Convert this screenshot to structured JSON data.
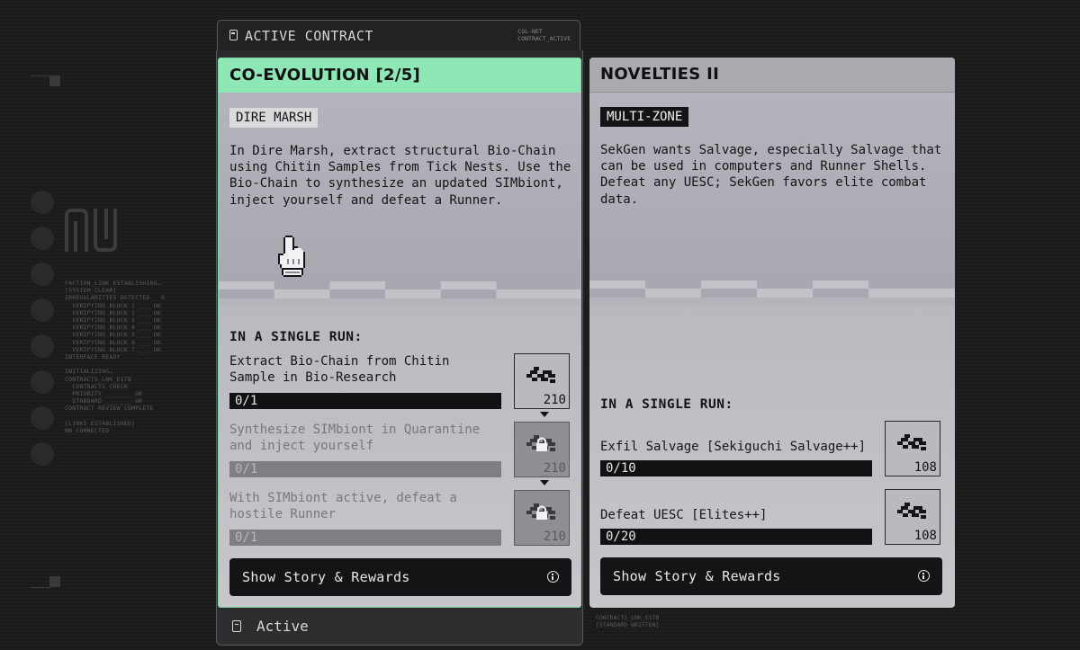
{
  "header": {
    "title": "ACTIVE CONTRACT",
    "meta_line1": "COL-NET",
    "meta_line2": "CONTRACT_ACTIVE"
  },
  "side_log": {
    "lines": [
      "FACTION_LINK ESTABLISHING…",
      "[SYSTEM CLEAR]",
      "IRREGULARITIES DETECTED _ 0",
      "  VERIFYING BLOCK 1 ___ OK",
      "  VERIFYING BLOCK 2 ___ OK",
      "  VERIFYING BLOCK 3 ___ OK",
      "  VERIFYING BLOCK 4 ___ OK",
      "  VERIFYING BLOCK 5 ___ OK",
      "  VERIFYING BLOCK 6 ___ OK",
      "  VERIFYING BLOCK 7 ___ OK",
      "INTERFACE READY",
      "",
      "INITIALIZING…",
      "CONTRACTS_LNK_ESTB",
      "  CONTRACTS CHECK",
      "  PRIORITY _______ OK",
      "  STANDARD _______ OK",
      "CONTRACT REVIEW COMPLETE",
      "",
      "[LINKS ESTABLISHED]",
      "NN CONNECTED"
    ]
  },
  "footer_tiny": {
    "line1": "CONTRACTS_LNK_ESTB",
    "line2": "[STANDARD WRITTEN]"
  },
  "contracts": [
    {
      "title": "CO-EVOLUTION [2/5]",
      "zone": "DIRE MARSH",
      "description": "In Dire Marsh, extract structural Bio-Chain using Chitin Samples from Tick Nests. Use the Bio-Chain to synthesize an updated SIMbiont, inject yourself and defeat a Runner.",
      "section_label": "IN A SINGLE RUN:",
      "tasks": [
        {
          "label": "Extract Bio-Chain from Chitin Sample in Bio-Research",
          "progress": "0/1",
          "reward": "210",
          "locked": false
        },
        {
          "label": "Synthesize SIMbiont in Quarantine and inject yourself",
          "progress": "0/1",
          "reward": "210",
          "locked": true
        },
        {
          "label": "With SIMbiont active, defeat a hostile Runner",
          "progress": "0/1",
          "reward": "210",
          "locked": true
        }
      ],
      "button_label": "Show Story & Rewards",
      "status_label": "Active"
    },
    {
      "title": "NOVELTIES II",
      "zone": "MULTI-ZONE",
      "description": "SekGen wants Salvage, especially Salvage that can be used in computers and Runner Shells. Defeat any UESC; SekGen favors elite combat data.",
      "section_label": "IN A SINGLE RUN:",
      "tasks": [
        {
          "label": "Exfil Salvage [Sekiguchi Salvage++]",
          "progress": "0/10",
          "reward": "108",
          "locked": false
        },
        {
          "label": "Defeat UESC [Elites++]",
          "progress": "0/20",
          "reward": "108",
          "locked": false
        }
      ],
      "button_label": "Show Story & Rewards"
    }
  ],
  "colors": {
    "active_accent": "#8ee8b6",
    "card_bg": "#b6b6be",
    "dark": "#141416",
    "page_bg": "#1b1b1c"
  }
}
